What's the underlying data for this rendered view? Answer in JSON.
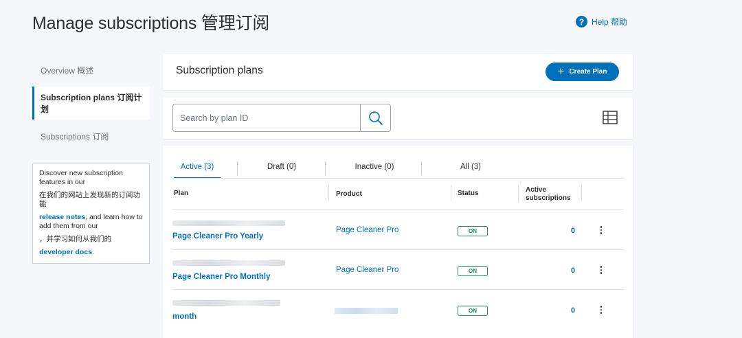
{
  "header": {
    "title": "Manage subscriptions  管理订阅",
    "help_label": "Help  帮助",
    "help_icon": "question-circle-icon"
  },
  "sidebar": {
    "items": [
      {
        "label": "Overview  概述"
      },
      {
        "label": "Subscription plans  订阅计划"
      },
      {
        "label": "Subscriptions  订阅"
      }
    ],
    "promo": {
      "line1": "Discover new subscription features in our",
      "line1_cn": "在我们的网站上发现新的订阅功能",
      "link1": "release notes",
      "line2": ", and learn how to add them from our",
      "line2_cn": "，并学习如何从我们的",
      "link2": "developer docs",
      "end": "."
    }
  },
  "plans_card": {
    "title": "Subscription plans",
    "create_label": "Create Plan"
  },
  "search": {
    "placeholder": "Search by plan ID",
    "search_icon": "search-icon",
    "view_icon": "table-view-icon"
  },
  "tabs": [
    {
      "label": "Active (3)"
    },
    {
      "label": "Draft (0)"
    },
    {
      "label": "Inactive (0)"
    },
    {
      "label": "All (3)"
    }
  ],
  "table": {
    "columns": {
      "plan": "Plan",
      "product": "Product",
      "status": "Status",
      "active_subscriptions": "Active subscriptions"
    },
    "rows": [
      {
        "plan": "Page Cleaner Pro Yearly",
        "product": "Page Cleaner Pro",
        "status": "ON",
        "count": "0"
      },
      {
        "plan": "Page Cleaner Pro Monthly",
        "product": "Page Cleaner Pro",
        "status": "ON",
        "count": "0"
      },
      {
        "plan": "month",
        "product": "",
        "status": "ON",
        "count": "0"
      }
    ]
  },
  "colors": {
    "accent": "#0070ba",
    "status_on": "#1d8a4f",
    "background": "#f5f7fa"
  }
}
